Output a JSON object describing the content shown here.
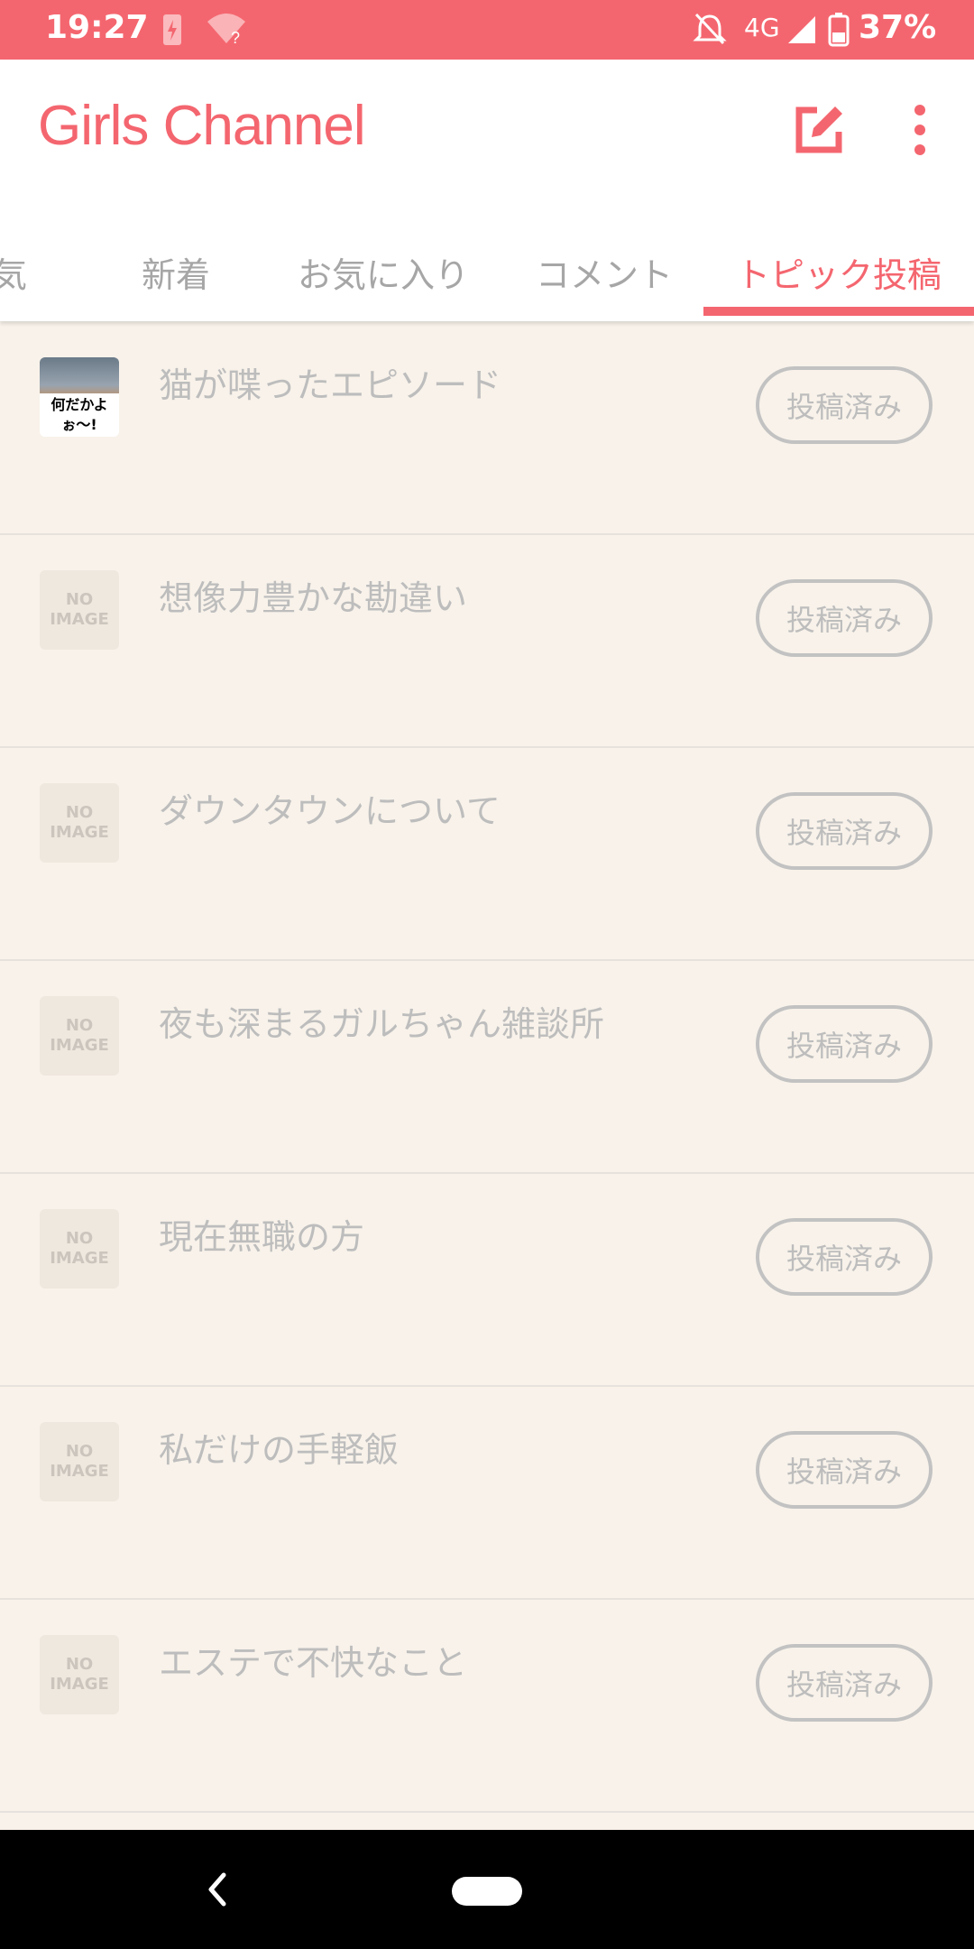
{
  "status_bar": {
    "time": "19:27",
    "network": "4G",
    "battery": "37%",
    "icons": [
      "battery-saver-icon",
      "wifi-unknown-icon",
      "alarm-off-icon",
      "signal-icon",
      "battery-icon"
    ]
  },
  "app_bar": {
    "title": "Girls Channel",
    "accent_color": "#f4666f",
    "actions": [
      "compose-icon",
      "more-vert-icon"
    ]
  },
  "tabs": [
    {
      "label": "気",
      "active": false
    },
    {
      "label": "新着",
      "active": false
    },
    {
      "label": "お気に入り",
      "active": false
    },
    {
      "label": "コメント",
      "active": false
    },
    {
      "label": "トピック投稿",
      "active": true
    }
  ],
  "topics": [
    {
      "title": "猫が喋ったエピソード",
      "status": "投稿済み",
      "thumb": "photo",
      "thumb_caption": "何だかよぉ〜!"
    },
    {
      "title": "想像力豊かな勘違い",
      "status": "投稿済み",
      "thumb": "none"
    },
    {
      "title": "ダウンタウンについて",
      "status": "投稿済み",
      "thumb": "none"
    },
    {
      "title": "夜も深まるガルちゃん雑談所",
      "status": "投稿済み",
      "thumb": "none"
    },
    {
      "title": "現在無職の方",
      "status": "投稿済み",
      "thumb": "none"
    },
    {
      "title": "私だけの手軽飯",
      "status": "投稿済み",
      "thumb": "none"
    },
    {
      "title": "エステで不快なこと",
      "status": "投稿済み",
      "thumb": "none"
    }
  ],
  "no_image": {
    "line1": "NO",
    "line2": "IMAGE"
  }
}
